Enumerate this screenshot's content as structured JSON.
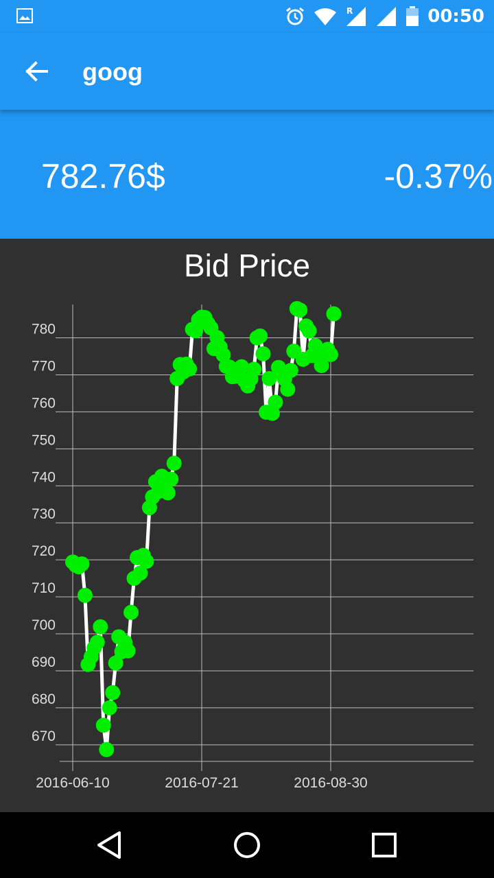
{
  "status_bar": {
    "time": "00:50",
    "icons": [
      "gallery-icon",
      "alarm-icon",
      "wifi-icon",
      "signal-roaming-icon",
      "signal-icon",
      "battery-icon"
    ]
  },
  "app_bar": {
    "title": "goog",
    "back_icon": "arrow-back-icon"
  },
  "quote": {
    "price": "782.76$",
    "change": "-0.37%"
  },
  "colors": {
    "primary": "#2196f3",
    "chart_bg": "#303030",
    "line": "#ffffff",
    "points": "#00ee00",
    "grid": "#bdbdbd"
  },
  "chart_data": {
    "type": "line",
    "title": "Bid Price",
    "xlabel": "",
    "ylabel": "",
    "x_ticks": [
      "2016-06-10",
      "2016-07-21",
      "2016-08-30"
    ],
    "y_ticks": [
      670,
      680,
      690,
      700,
      710,
      720,
      730,
      740,
      750,
      760,
      770,
      780
    ],
    "ylim": [
      667,
      789
    ],
    "grid": true,
    "series": [
      {
        "values": [
          719.4,
          718.5,
          718.1,
          718.9,
          710.4,
          691.7,
          693.8,
          696.2,
          697.7,
          701.9,
          675.3,
          668.7,
          680.0,
          684.1,
          692.1,
          699.2,
          695.2,
          697.7,
          695.4,
          705.8,
          715.0,
          720.6,
          716.4,
          721.2,
          719.6,
          734.1,
          737.0,
          741.1,
          738.5,
          742.6,
          740.2,
          738.1,
          741.8,
          746.1,
          769.0,
          772.8,
          770.8,
          772.9,
          771.6,
          782.3,
          781.9,
          784.9,
          785.6,
          785.5,
          783.9,
          782.7,
          777.1,
          780.1,
          777.5,
          775.4,
          772.3,
          772.1,
          769.5,
          769.6,
          770.0,
          772.2,
          768.4,
          767.0,
          768.9,
          771.5,
          780.0,
          780.5,
          775.7,
          759.9,
          769.0,
          759.6,
          762.6,
          772.0,
          770.6,
          768.9,
          766.1,
          771.2,
          776.4,
          787.9,
          787.5,
          774.2,
          783.2,
          781.9,
          775.2,
          777.9,
          775.8,
          772.5,
          776.2,
          776.9,
          775.5,
          786.5
        ]
      }
    ]
  },
  "nav_bar": {
    "buttons": [
      "back-triangle-icon",
      "home-circle-icon",
      "recents-square-icon"
    ]
  }
}
